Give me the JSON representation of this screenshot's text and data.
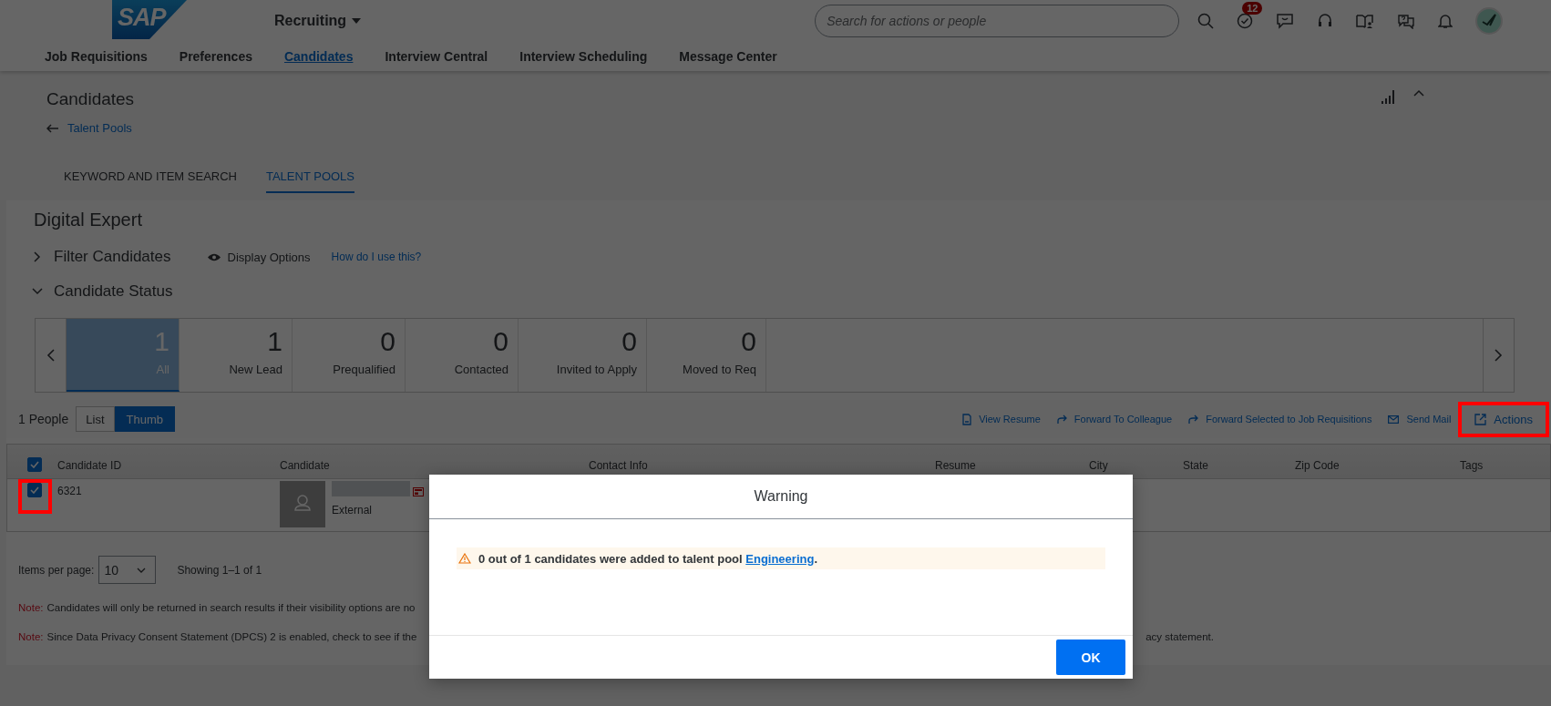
{
  "shell": {
    "logo": "SAP",
    "product": "Recruiting",
    "search": {
      "placeholder": "Search for actions or people"
    },
    "tasks_badge": "12"
  },
  "nav": [
    {
      "label": "Job Requisitions",
      "selected": false
    },
    {
      "label": "Preferences",
      "selected": false
    },
    {
      "label": "Candidates",
      "selected": true
    },
    {
      "label": "Interview Central",
      "selected": false
    },
    {
      "label": "Interview Scheduling",
      "selected": false
    },
    {
      "label": "Message Center",
      "selected": false
    }
  ],
  "page": {
    "title": "Candidates",
    "back_link": "Talent Pools"
  },
  "tabs": [
    {
      "label": "KEYWORD AND ITEM SEARCH",
      "selected": false
    },
    {
      "label": "TALENT POOLS",
      "selected": true
    }
  ],
  "pool": {
    "title": "Digital Expert",
    "filter": {
      "label": "Filter Candidates",
      "expanded": false
    },
    "display_options": "Display Options",
    "help_link": "How do I use this?",
    "status": {
      "label": "Candidate Status",
      "expanded": true
    }
  },
  "status_tiles": [
    {
      "count": "1",
      "label": "All",
      "selected": true
    },
    {
      "count": "1",
      "label": "New Lead",
      "selected": false
    },
    {
      "count": "0",
      "label": "Prequalified",
      "selected": false
    },
    {
      "count": "0",
      "label": "Contacted",
      "selected": false
    },
    {
      "count": "0",
      "label": "Invited to Apply",
      "selected": false
    },
    {
      "count": "0",
      "label": "Moved to Req",
      "selected": false
    }
  ],
  "results": {
    "count": "1 People",
    "views": [
      {
        "label": "List",
        "selected": false
      },
      {
        "label": "Thumb",
        "selected": true
      }
    ],
    "actions": [
      {
        "label": "View Resume",
        "kind": "resume",
        "highlighted": false
      },
      {
        "label": "Forward To Colleague",
        "kind": "forward",
        "highlighted": false
      },
      {
        "label": "Forward Selected to Job Requisitions",
        "kind": "forward",
        "highlighted": false
      },
      {
        "label": "Send Mail",
        "kind": "mail",
        "highlighted": false
      },
      {
        "label": "Actions",
        "kind": "actions",
        "highlighted": true
      }
    ]
  },
  "table": {
    "select_all": {
      "checked": true
    },
    "columns": [
      "Candidate ID",
      "Candidate",
      "Contact Info",
      "Resume",
      "City",
      "State",
      "Zip Code",
      "Tags"
    ],
    "rows": [
      {
        "checked": true,
        "highlighted": true,
        "id": "6321",
        "type": "External"
      }
    ]
  },
  "pagination": {
    "label": "Items per page:",
    "value": "10",
    "summary": "Showing 1–1 of 1"
  },
  "notes": [
    {
      "label": "Note:",
      "text": "Candidates will only be returned in search results if their visibility options are no"
    },
    {
      "label": "Note:",
      "text": "Since Data Privacy Consent Statement (DPCS) 2 is enabled, check to see if the",
      "tail": "acy statement."
    }
  ],
  "dialog": {
    "title": "Warning",
    "message_before": "0 out of 1 candidates were added to talent pool ",
    "link": "Engineering",
    "message_after": ".",
    "button": "OK"
  }
}
